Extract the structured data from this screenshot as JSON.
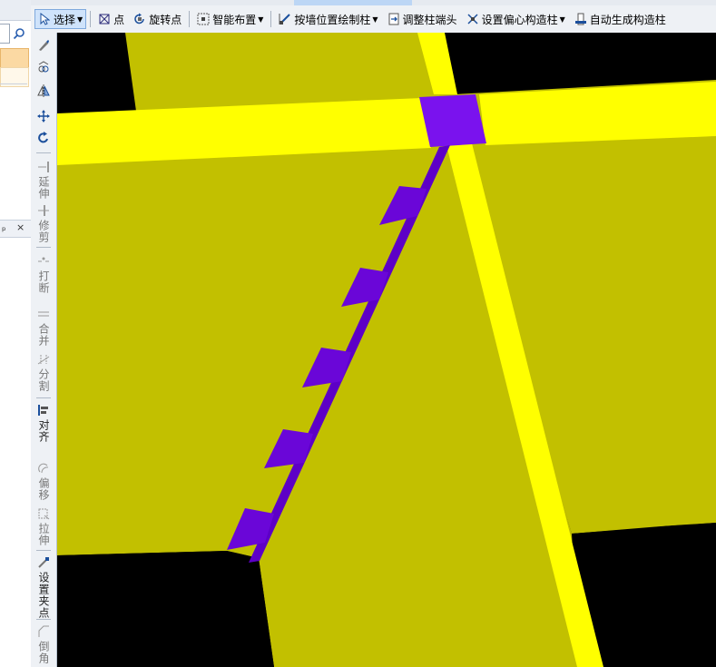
{
  "toolbar": {
    "select_label": "选择",
    "point_label": "点",
    "rotate_point_label": "旋转点",
    "smart_layout_label": "智能布置",
    "draw_by_wall_label": "按墙位置绘制柱",
    "adjust_end_label": "调整柱端头",
    "set_eccentric_label": "设置偏心构造柱",
    "auto_generate_label": "自动生成构造柱"
  },
  "modify_tools": [
    {
      "label": "",
      "icon": "brush-icon"
    },
    {
      "label": "",
      "icon": "copy-icon"
    },
    {
      "label": "",
      "icon": "mirror-icon"
    },
    {
      "label": "",
      "icon": "move-icon"
    },
    {
      "label": "",
      "icon": "rotate-icon"
    },
    {
      "label": "延伸",
      "icon": "extend-icon"
    },
    {
      "label": "修剪",
      "icon": "trim-icon"
    },
    {
      "label": "打断",
      "icon": "break-icon"
    },
    {
      "label": "合并",
      "icon": "merge-icon"
    },
    {
      "label": "分割",
      "icon": "split-icon"
    },
    {
      "label": "对齐",
      "icon": "align-icon"
    },
    {
      "label": "偏移",
      "icon": "offset-icon"
    },
    {
      "label": "拉伸",
      "icon": "stretch-icon"
    },
    {
      "label": "设置夹点",
      "icon": "grip-icon"
    },
    {
      "label": "倒角",
      "icon": "chamfer-icon"
    }
  ],
  "left_panel": {
    "pin_glyph": "ₚ",
    "close_glyph": "×"
  },
  "colors": {
    "slab": "#c2c000",
    "beam": "#ffff00",
    "column": "#7a12ee",
    "wall": "#5d00c6",
    "background": "#000000"
  }
}
